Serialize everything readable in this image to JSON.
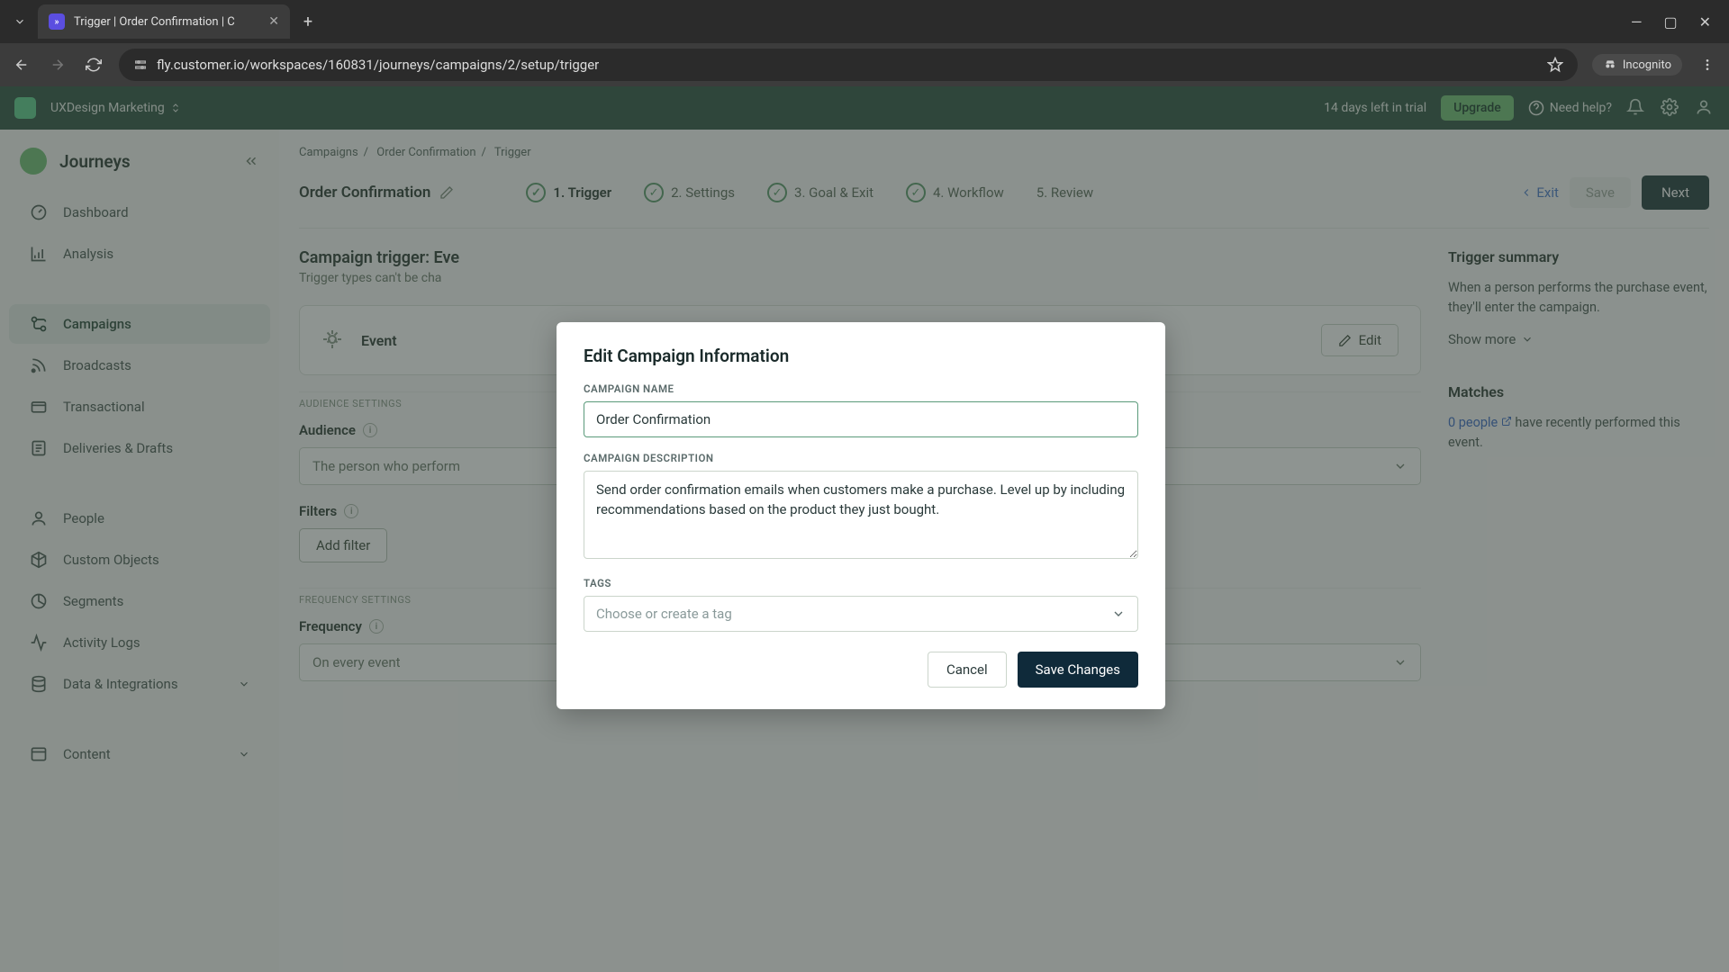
{
  "browser": {
    "tab_title": "Trigger | Order Confirmation | C",
    "url": "fly.customer.io/workspaces/160831/journeys/campaigns/2/setup/trigger",
    "incognito": "Incognito"
  },
  "topbar": {
    "workspace": "UXDesign Marketing",
    "trial": "14 days left in trial",
    "upgrade": "Upgrade",
    "help": "Need help?"
  },
  "sidebar": {
    "title": "Journeys",
    "items": [
      {
        "label": "Dashboard"
      },
      {
        "label": "Analysis"
      },
      {
        "label": "Campaigns"
      },
      {
        "label": "Broadcasts"
      },
      {
        "label": "Transactional"
      },
      {
        "label": "Deliveries & Drafts"
      },
      {
        "label": "People"
      },
      {
        "label": "Custom Objects"
      },
      {
        "label": "Segments"
      },
      {
        "label": "Activity Logs"
      },
      {
        "label": "Data & Integrations"
      },
      {
        "label": "Content"
      }
    ]
  },
  "crumbs": {
    "a": "Campaigns",
    "b": "Order Confirmation",
    "c": "Trigger"
  },
  "page": {
    "title": "Order Confirmation",
    "steps": [
      "1. Trigger",
      "2. Settings",
      "3. Goal & Exit",
      "4. Workflow",
      "5. Review"
    ],
    "exit": "Exit",
    "save": "Save",
    "next": "Next"
  },
  "main": {
    "heading": "Campaign trigger: Eve",
    "sub": "Trigger types can't be cha",
    "event_label": "Event",
    "edit": "Edit",
    "audience_settings": "AUDIENCE SETTINGS",
    "audience": "Audience",
    "audience_value": "The person who perform",
    "filters": "Filters",
    "add_filter": "Add filter",
    "freq_settings": "FREQUENCY SETTINGS",
    "frequency": "Frequency",
    "frequency_value": "On every event"
  },
  "summary": {
    "title": "Trigger summary",
    "text": "When a person performs the purchase event, they'll enter the campaign.",
    "showmore": "Show more",
    "matches": "Matches",
    "people": "0 people",
    "matches_txt": " have recently performed this event."
  },
  "modal": {
    "title": "Edit Campaign Information",
    "name_label": "CAMPAIGN NAME",
    "name_value": "Order Confirmation",
    "desc_label": "CAMPAIGN DESCRIPTION",
    "desc_value": "Send order confirmation emails when customers make a purchase. Level up by including recommendations based on the product they just bought.",
    "tags_label": "TAGS",
    "tags_placeholder": "Choose or create a tag",
    "cancel": "Cancel",
    "save": "Save Changes"
  }
}
